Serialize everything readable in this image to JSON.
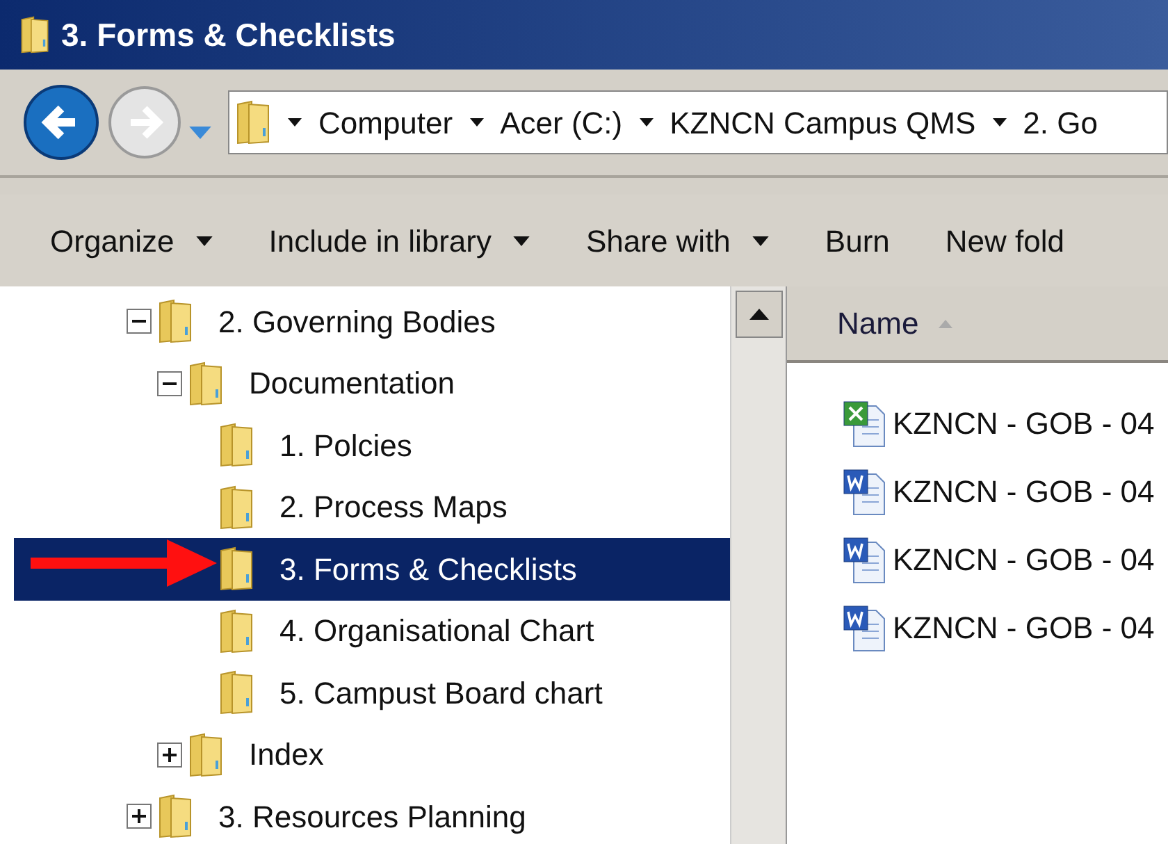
{
  "window": {
    "title": "3. Forms & Checklists"
  },
  "address_bar": {
    "breadcrumbs": [
      "Computer",
      "Acer (C:)",
      "KZNCN Campus QMS",
      "2. Go"
    ]
  },
  "toolbar": [
    {
      "label": "Organize",
      "dropdown": true
    },
    {
      "label": "Include in library",
      "dropdown": true
    },
    {
      "label": "Share with",
      "dropdown": true
    },
    {
      "label": "Burn",
      "dropdown": false
    },
    {
      "label": "New fold",
      "dropdown": false
    }
  ],
  "tree": [
    {
      "label": "2. Governing Bodies",
      "kind": "branch",
      "expanded": true,
      "selected": false,
      "children": [
        {
          "label": "Documentation",
          "kind": "branch",
          "expanded": true,
          "selected": false,
          "children": [
            {
              "label": "1. Polcies",
              "kind": "leaf",
              "selected": false
            },
            {
              "label": "2. Process Maps",
              "kind": "leaf",
              "selected": false
            },
            {
              "label": "3. Forms & Checklists",
              "kind": "leaf",
              "selected": true
            },
            {
              "label": "4. Organisational Chart",
              "kind": "leaf",
              "selected": false
            },
            {
              "label": "5. Campust Board chart",
              "kind": "leaf",
              "selected": false
            }
          ]
        },
        {
          "label": "Index",
          "kind": "branch",
          "expanded": false,
          "selected": false
        }
      ]
    },
    {
      "label": "3. Resources Planning",
      "kind": "branch",
      "expanded": false,
      "selected": false
    }
  ],
  "file_list": {
    "columns": [
      "Name"
    ],
    "files": [
      {
        "name": "KZNCN - GOB - 04",
        "kind": "excel"
      },
      {
        "name": "KZNCN - GOB - 04",
        "kind": "word"
      },
      {
        "name": "KZNCN - GOB - 04",
        "kind": "word"
      },
      {
        "name": "KZNCN - GOB - 04",
        "kind": "word"
      }
    ]
  }
}
